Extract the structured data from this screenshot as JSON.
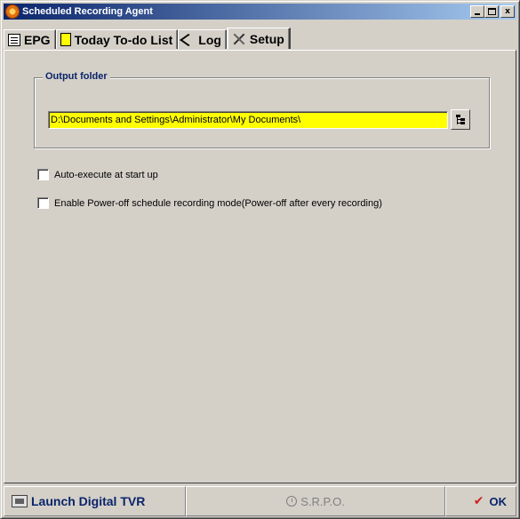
{
  "window": {
    "title": "Scheduled Recording Agent",
    "controls": {
      "minimize": "_",
      "maximize": "□",
      "close": "x"
    }
  },
  "tabs": [
    {
      "label": "EPG",
      "icon": "epg-icon",
      "active": false
    },
    {
      "label": "Today To-do List",
      "icon": "todo-icon",
      "active": false
    },
    {
      "label": "Log",
      "icon": "log-icon",
      "active": false
    },
    {
      "label": "Setup",
      "icon": "setup-icon",
      "active": true
    }
  ],
  "setup": {
    "output_folder": {
      "legend": "Output folder",
      "path": "D:\\Documents and Settings\\Administrator\\My Documents\\",
      "input_color": "#ffff00",
      "browse_icon": "folder-tree-icon"
    },
    "options": [
      {
        "label": "Auto-execute at start up",
        "checked": false
      },
      {
        "label": "Enable Power-off schedule recording mode(Power-off after every recording)",
        "checked": false
      }
    ]
  },
  "bottom_bar": {
    "launch_label": "Launch Digital TVR",
    "srpo_label": "S.R.P.O.",
    "ok_label": "OK"
  },
  "colors": {
    "title_gradient_start": "#0a246a",
    "title_gradient_end": "#a6caf0",
    "legend_text": "#0a246a",
    "face": "#d4d0c8",
    "ok_check": "#d02020"
  }
}
